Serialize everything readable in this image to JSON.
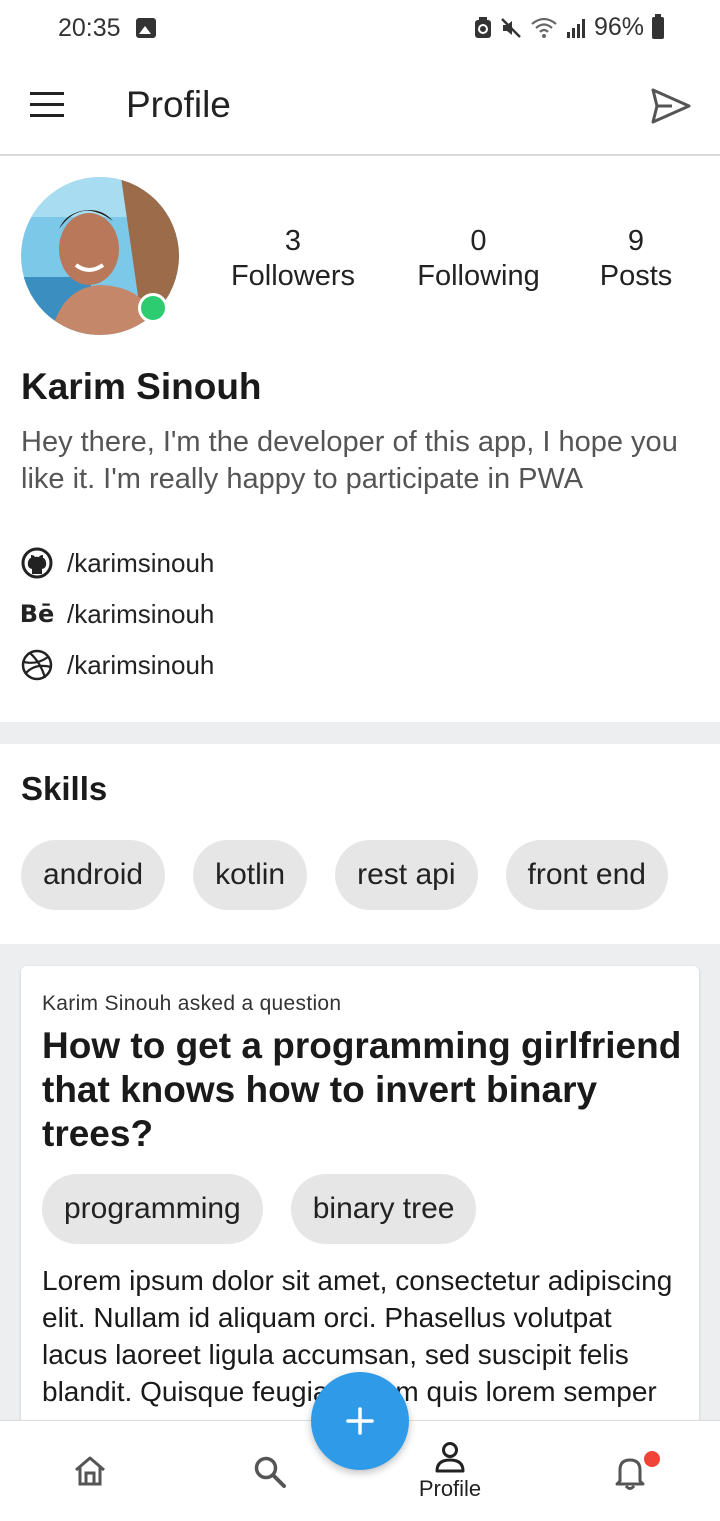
{
  "status_bar": {
    "time": "20:35",
    "battery": "96%"
  },
  "app_bar": {
    "title": "Profile"
  },
  "profile": {
    "stats": [
      {
        "value": "3",
        "label": "Followers"
      },
      {
        "value": "0",
        "label": "Following"
      },
      {
        "value": "9",
        "label": "Posts"
      }
    ],
    "name": "Karim Sinouh",
    "bio": "Hey there, I'm the developer of this app, I hope you like it. I'm really happy to participate in PWA",
    "links": [
      {
        "icon": "github-icon",
        "text": "/karimsinouh"
      },
      {
        "icon": "behance-icon",
        "glyph": "Bē",
        "text": "/karimsinouh"
      },
      {
        "icon": "dribbble-icon",
        "text": "/karimsinouh"
      }
    ],
    "online_color": "#2ecc71"
  },
  "skills": {
    "title": "Skills",
    "items": [
      "android",
      "kotlin",
      "rest api",
      "front end"
    ]
  },
  "post": {
    "meta": "Karim Sinouh asked a question",
    "title": "How to get a programming girlfriend that knows how to invert binary trees?",
    "tags": [
      "programming",
      "binary tree"
    ],
    "body": "Lorem ipsum dolor sit amet, consectetur adipiscing elit. Nullam id aliquam orci. Phasellus volutpat lacus laoreet ligula accumsan, sed suscipit felis blandit. Quisque feugiat ipsum quis lorem semper"
  },
  "bottom_nav": {
    "profile_label": "Profile",
    "fab_icon": "plus-icon",
    "accent": "#2f9be8",
    "notification_dot_color": "#f04438"
  }
}
